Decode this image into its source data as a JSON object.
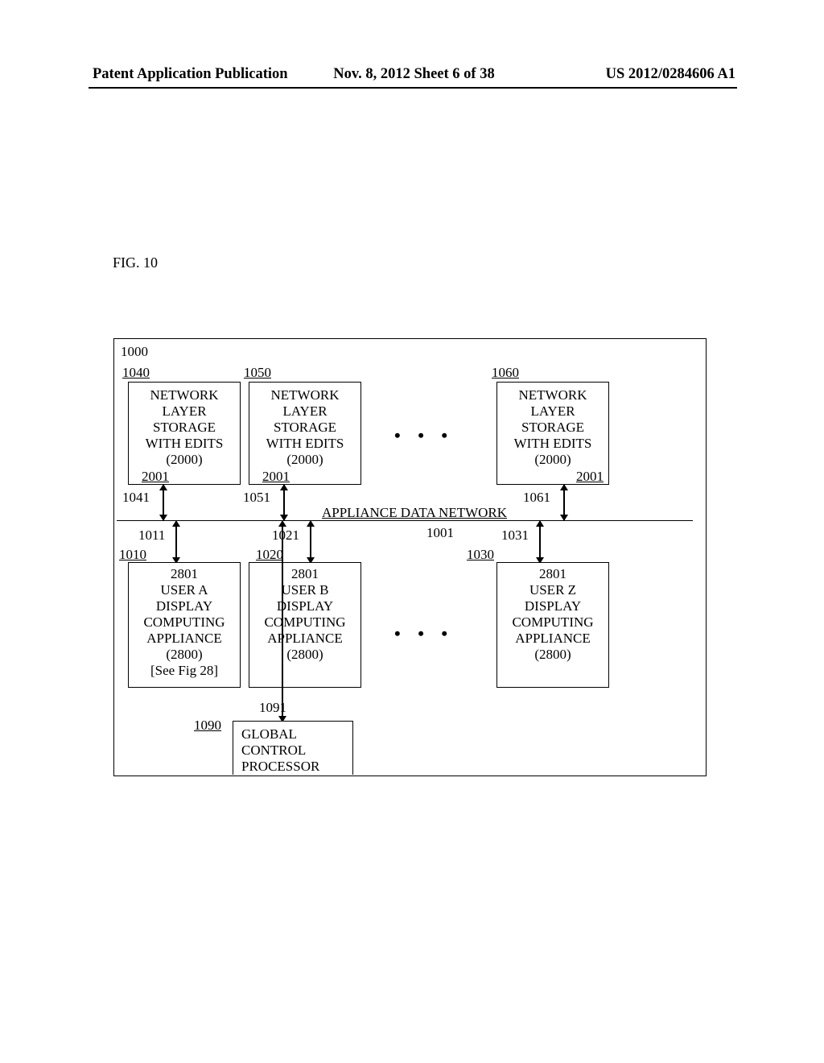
{
  "header": {
    "left": "Patent Application Publication",
    "center": "Nov. 8, 2012  Sheet 6 of 38",
    "right": "US 2012/0284606 A1"
  },
  "figure_label": "FIG. 10",
  "refs": {
    "outer": "1000",
    "s1": "1040",
    "s2": "1050",
    "s3": "1060",
    "z1": "2001",
    "z2": "2001",
    "z3": "2001",
    "a1041": "1041",
    "a1051": "1051",
    "a1061": "1061",
    "bus": "APPLIANCE DATA NETWORK",
    "busref": "1001",
    "a1011": "1011",
    "a1021": "1021",
    "a1031": "1031",
    "u1": "1010",
    "u2": "1020",
    "u3": "1030",
    "a1091": "1091",
    "gcp": "1090"
  },
  "storage": {
    "l1": "NETWORK",
    "l2": "LAYER",
    "l3": "STORAGE",
    "l4": "WITH EDITS",
    "l5": "(2000)"
  },
  "users": {
    "a": {
      "top": "2801",
      "l1": "USER A",
      "l2": "DISPLAY",
      "l3": "COMPUTING",
      "l4": "APPLIANCE",
      "l5": "(2800)",
      "l6": "[See Fig 28]"
    },
    "b": {
      "top": "2801",
      "l1": "USER B",
      "l2": "DISPLAY",
      "l3": "COMPUTING",
      "l4": "APPLIANCE",
      "l5": "(2800)"
    },
    "z": {
      "top": "2801",
      "l1": "USER Z",
      "l2": "DISPLAY",
      "l3": "COMPUTING",
      "l4": "APPLIANCE",
      "l5": "(2800)"
    }
  },
  "gcp": {
    "l1": "GLOBAL",
    "l2": "CONTROL",
    "l3": "PROCESSOR"
  },
  "dots": "•  •  •",
  "chart_data": {
    "type": "diagram",
    "title": "FIG. 10",
    "container_ref": "1000",
    "bus": {
      "ref": "1001",
      "label": "APPLIANCE DATA NETWORK"
    },
    "storage_nodes": [
      {
        "ref": "1040",
        "label": "NETWORK LAYER STORAGE WITH EDITS (2000)",
        "subref": "2001",
        "link_to_bus_ref": "1041"
      },
      {
        "ref": "1050",
        "label": "NETWORK LAYER STORAGE WITH EDITS (2000)",
        "subref": "2001",
        "link_to_bus_ref": "1051"
      },
      {
        "ref": "1060",
        "label": "NETWORK LAYER STORAGE WITH EDITS (2000)",
        "subref": "2001",
        "link_to_bus_ref": "1061"
      }
    ],
    "appliance_nodes": [
      {
        "ref": "1010",
        "label": "USER A DISPLAY COMPUTING APPLIANCE (2800) [See Fig 28]",
        "subref": "2801",
        "link_to_bus_ref": "1011"
      },
      {
        "ref": "1020",
        "label": "USER B DISPLAY COMPUTING APPLIANCE (2800)",
        "subref": "2801",
        "link_to_bus_ref": "1021"
      },
      {
        "ref": "1030",
        "label": "USER Z DISPLAY COMPUTING APPLIANCE (2800)",
        "subref": "2801",
        "link_to_bus_ref": "1031"
      }
    ],
    "global_control": {
      "ref": "1090",
      "label": "GLOBAL CONTROL PROCESSOR",
      "link_to_bus_ref": "1091"
    },
    "ellipsis_between": [
      "storage_nodes[1]..storage_nodes[2]",
      "appliance_nodes[1]..appliance_nodes[2]"
    ]
  }
}
